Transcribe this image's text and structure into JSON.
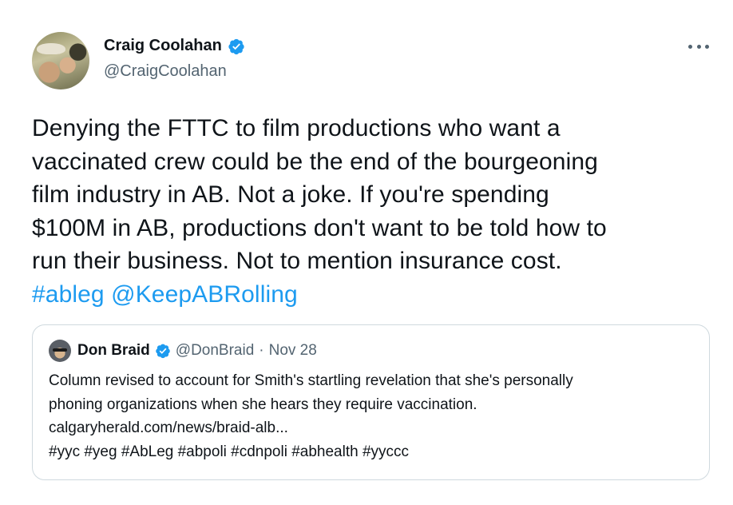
{
  "tweet": {
    "author": {
      "display_name": "Craig Coolahan",
      "handle": "@CraigCoolahan",
      "verified": true
    },
    "text_lines": [
      "Denying the FTTC to film productions who want a",
      "vaccinated crew could be the end of the bourgeoning",
      "film industry in AB. Not a joke. If you're spending",
      "$100M in AB, productions don't want to be told how to",
      "run their business. Not to mention insurance cost."
    ],
    "hashtag": "#ableg",
    "mention": "@KeepABRolling",
    "more_icon": "more-horizontal-icon"
  },
  "quoted_tweet": {
    "author": {
      "display_name": "Don Braid",
      "handle": "@DonBraid",
      "verified": true
    },
    "separator": "·",
    "date": "Nov 28",
    "body_lines": [
      "Column revised to account for Smith's startling revelation that she's personally",
      "phoning organizations when she hears they require vaccination.",
      "calgaryherald.com/news/braid-alb...",
      "#yyc #yeg #AbLeg #abpoli #cdnpoli #abhealth #yyccc"
    ]
  },
  "colors": {
    "text": "#0f1419",
    "secondary": "#536471",
    "link": "#1d9bf0",
    "border": "#cfd9de",
    "verified_badge": "#1d9bf0"
  }
}
